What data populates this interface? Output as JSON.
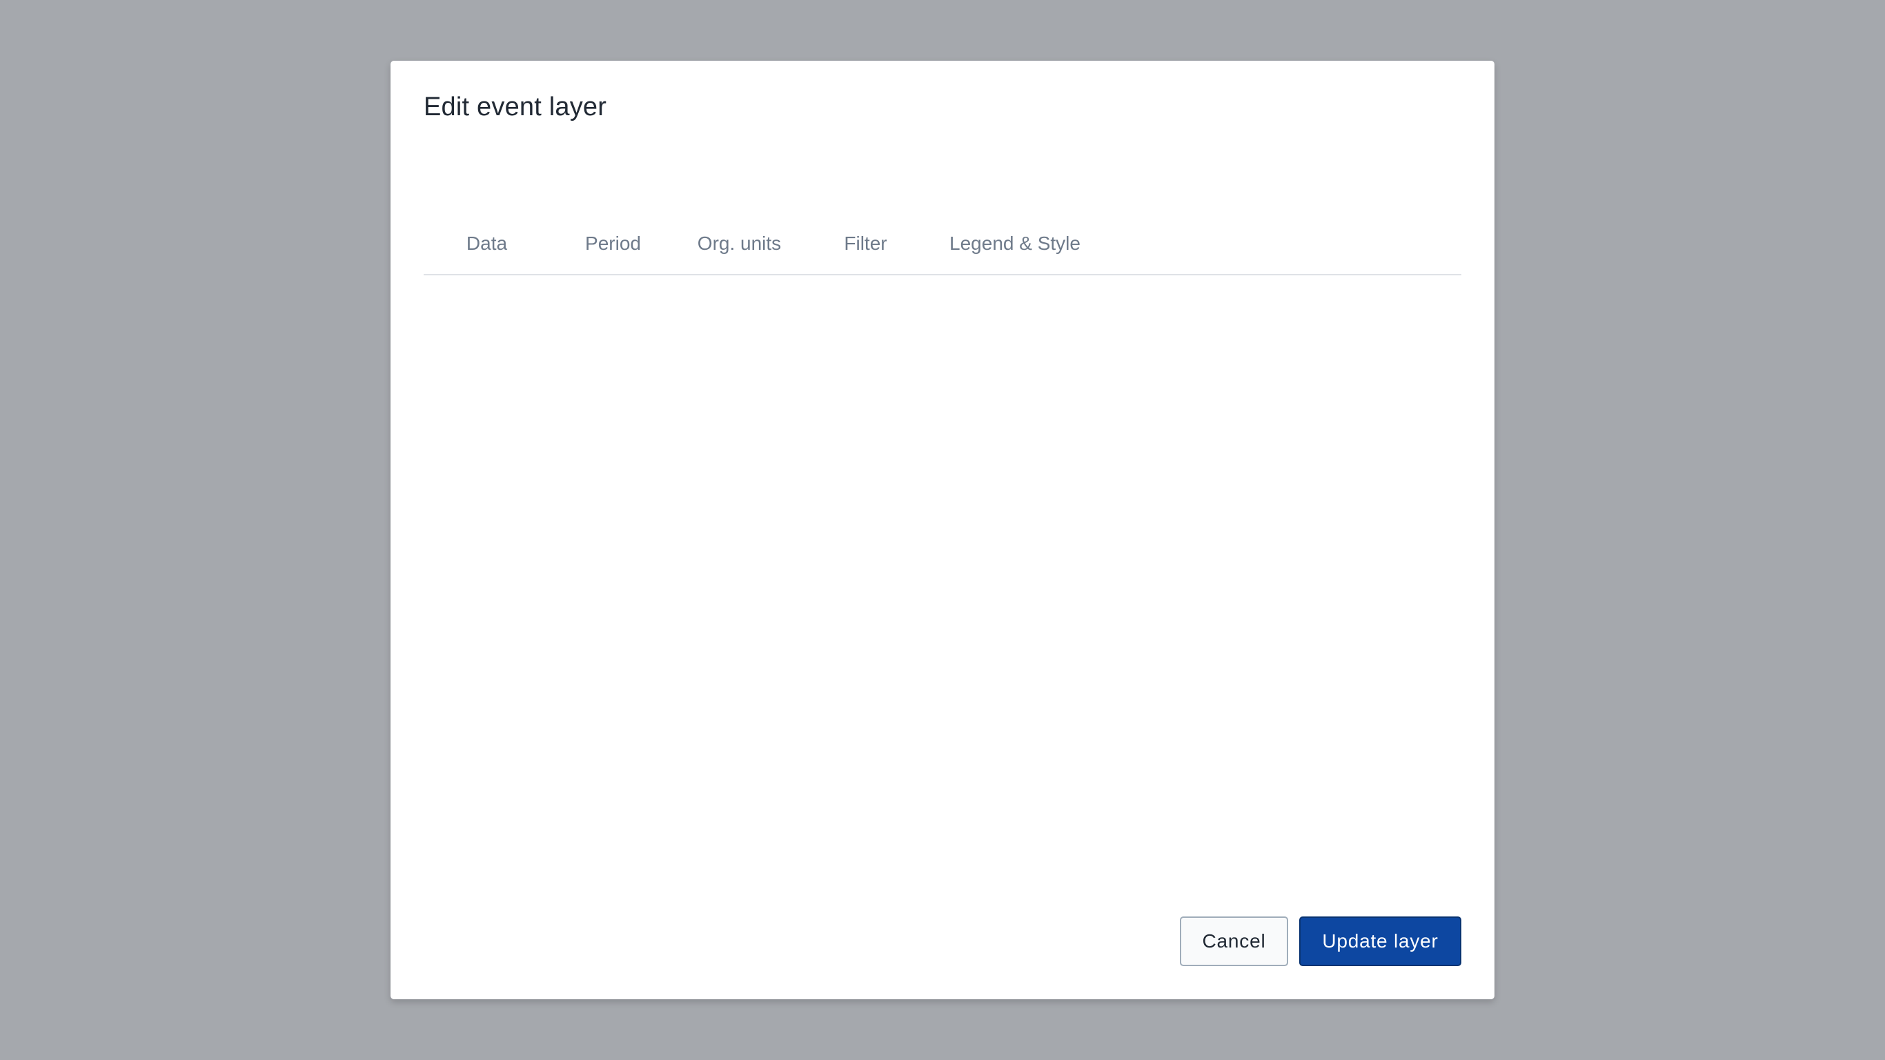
{
  "dialog": {
    "title": "Edit event layer",
    "tabs": [
      {
        "label": "Data"
      },
      {
        "label": "Period"
      },
      {
        "label": "Org. units"
      },
      {
        "label": "Filter"
      },
      {
        "label": "Legend & Style"
      }
    ],
    "actions": {
      "cancel_label": "Cancel",
      "update_label": "Update layer"
    }
  },
  "colors": {
    "overlay": "#a5a8ad",
    "primary_button": "#0d47a1",
    "tab_text": "#6e7a8a",
    "title_text": "#212934"
  }
}
